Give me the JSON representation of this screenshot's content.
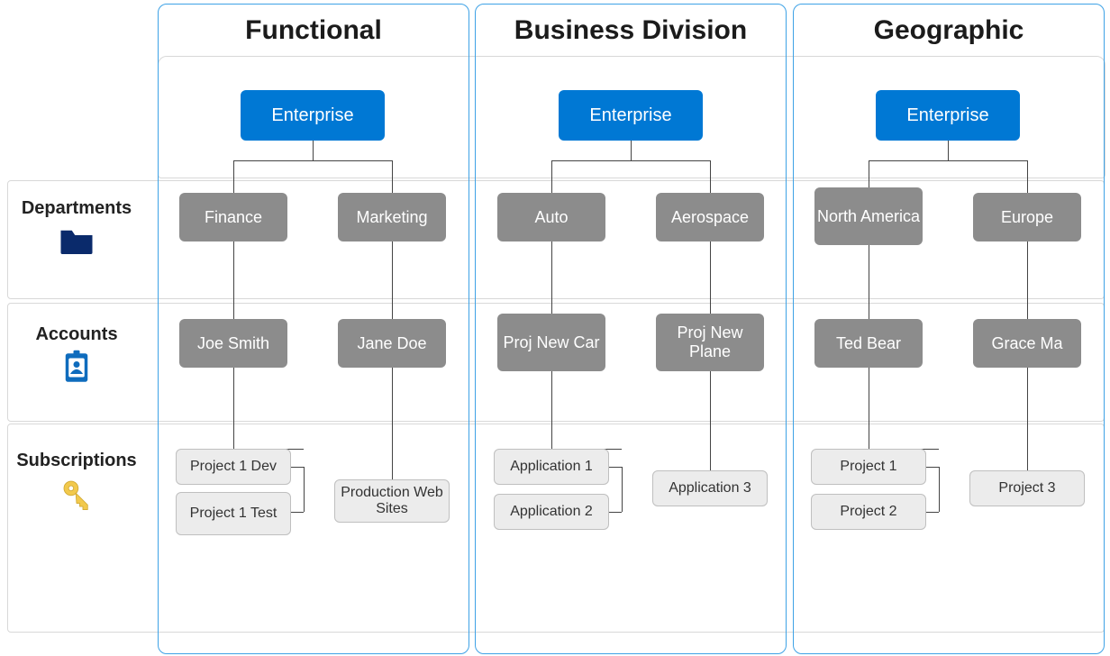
{
  "row_labels": {
    "departments": "Departments",
    "accounts": "Accounts",
    "subscriptions": "Subscriptions"
  },
  "columns": [
    {
      "title": "Functional",
      "enterprise": "Enterprise",
      "departments": [
        {
          "name": "Finance",
          "account": "Joe Smith",
          "subs": [
            "Project 1 Dev",
            "Project 1 Test"
          ]
        },
        {
          "name": "Marketing",
          "account": "Jane Doe",
          "subs": [
            "Production Web Sites"
          ]
        }
      ]
    },
    {
      "title": "Business Division",
      "enterprise": "Enterprise",
      "departments": [
        {
          "name": "Auto",
          "account": "Proj New Car",
          "subs": [
            "Application 1",
            "Application 2"
          ]
        },
        {
          "name": "Aerospace",
          "account": "Proj New Plane",
          "subs": [
            "Application 3"
          ]
        }
      ]
    },
    {
      "title": "Geographic",
      "enterprise": "Enterprise",
      "departments": [
        {
          "name": "North America",
          "account": "Ted Bear",
          "subs": [
            "Project 1",
            "Project 2"
          ]
        },
        {
          "name": "Europe",
          "account": "Grace Ma",
          "subs": [
            "Project 3"
          ]
        }
      ]
    }
  ]
}
